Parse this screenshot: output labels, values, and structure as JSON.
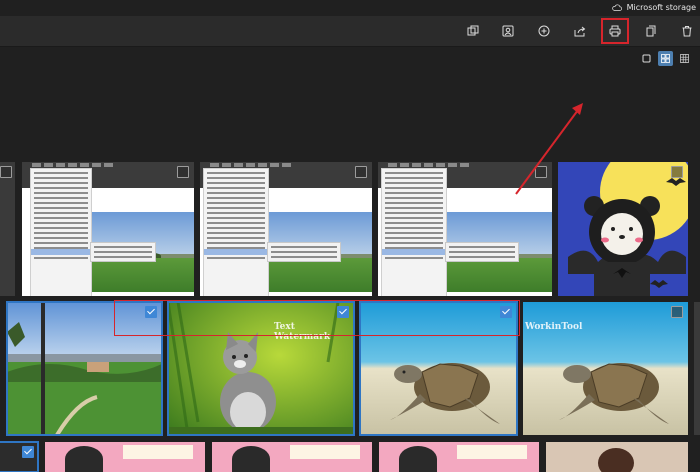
{
  "storage": {
    "label": "Microsoft storage",
    "icon": "cloud-icon"
  },
  "toolbar": {
    "buttons": [
      {
        "name": "duplicate-button",
        "icon": "copy-icon"
      },
      {
        "name": "people-button",
        "icon": "people-icon"
      },
      {
        "name": "add-button",
        "icon": "plus-circle-icon"
      },
      {
        "name": "share-button",
        "icon": "share-icon"
      },
      {
        "name": "print-button",
        "icon": "printer-icon"
      },
      {
        "name": "copy-to-button",
        "icon": "copy-to-icon"
      },
      {
        "name": "delete-button",
        "icon": "trash-icon"
      }
    ]
  },
  "view_modes": [
    "single",
    "grid-medium",
    "grid-small"
  ],
  "view_active": "grid-medium",
  "watermarks": {
    "kitten": "Text Watermark",
    "turtle": "WorkinTool"
  },
  "colors": {
    "accent": "#3f87d6",
    "highlight": "#d6252c",
    "background": "#202020"
  },
  "selection": {
    "row1_checked": [
      false,
      false,
      false,
      false,
      false
    ],
    "row2_checked": [
      true,
      true,
      true,
      false
    ],
    "row3_checked": [
      true
    ]
  }
}
